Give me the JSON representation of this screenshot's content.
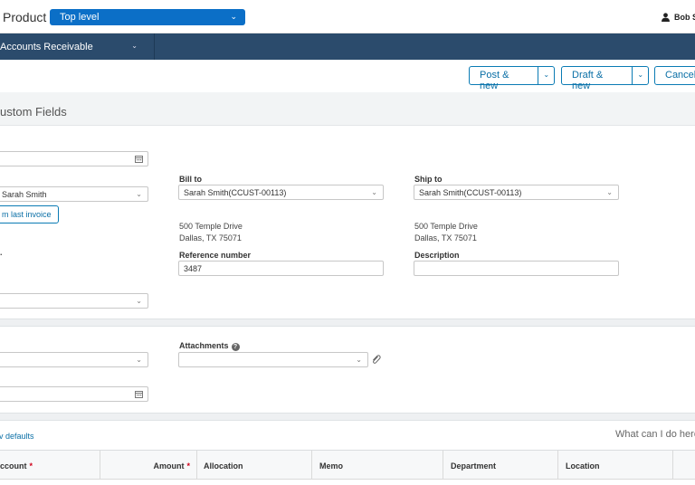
{
  "topbar": {
    "product_label": "Product",
    "entity_select": "Top level",
    "user_name": "Bob S"
  },
  "nav": {
    "module": "Accounts Receivable"
  },
  "actions": {
    "post_new": "Post & new",
    "draft_new": "Draft & new",
    "cancel": "Cancel"
  },
  "section": {
    "title": "ustom Fields"
  },
  "form": {
    "customer_value": "Sarah Smith",
    "copy_last_invoice": "m last invoice",
    "bill_to_label": "Bill to",
    "bill_to_value": "Sarah Smith(CCUST-00113)",
    "bill_to_address_line1": "500 Temple Drive",
    "bill_to_address_line2": "Dallas, TX 75071",
    "ship_to_label": "Ship to",
    "ship_to_value": "Sarah Smith(CCUST-00113)",
    "ship_to_address_line1": "500 Temple Drive",
    "ship_to_address_line2": "Dallas, TX 75071",
    "reference_label": "Reference number",
    "reference_value": "3487",
    "description_label": "Description",
    "description_value": "",
    "attachments_label": "Attachments"
  },
  "lines": {
    "defaults_link": "v defaults",
    "help_text": "What can I do here",
    "columns": [
      "ccount",
      "Amount",
      "Allocation",
      "Memo",
      "Department",
      "Location"
    ]
  },
  "colors": {
    "brand_blue": "#0b6fc7",
    "nav_bg": "#2b4b6c",
    "link": "#0a6fa6",
    "required": "#d0021b"
  }
}
